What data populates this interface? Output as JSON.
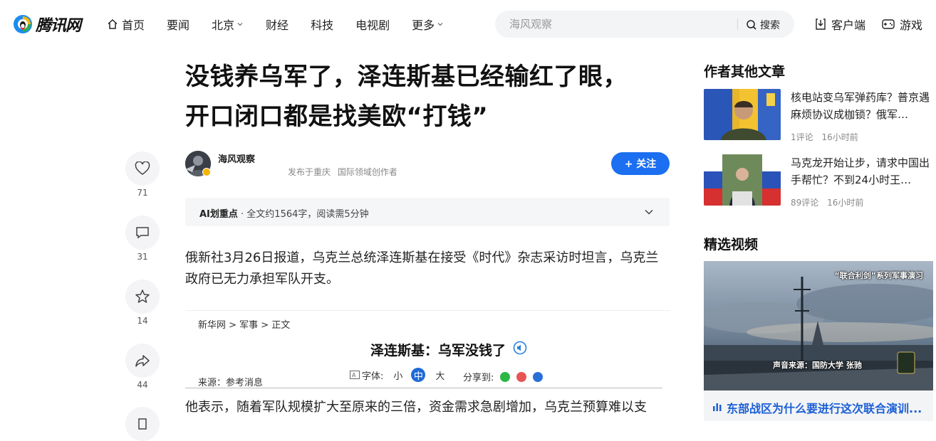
{
  "header": {
    "logo_text": "腾讯网",
    "nav": [
      {
        "label": "首页"
      },
      {
        "label": "要闻"
      },
      {
        "label": "北京"
      },
      {
        "label": "财经"
      },
      {
        "label": "科技"
      },
      {
        "label": "电视剧"
      },
      {
        "label": "更多"
      }
    ],
    "search_placeholder": "海风观察",
    "search_button": "搜索",
    "client_label": "客户端",
    "games_label": "游戏"
  },
  "rail": {
    "like_count": "71",
    "comment_count": "31",
    "favorite_count": "14",
    "share_count": "44"
  },
  "article": {
    "title_line1": "没钱养乌军了，泽连斯基已经输红了眼，",
    "title_line2": "开口闭口都是找美欧“打钱”",
    "author": "海风观察",
    "location": "发布于重庆",
    "author_title": "国际领域创作者",
    "follow_label": "+ 关注",
    "ai_label": "AI划重点",
    "ai_summary": " · 全文约1564字，阅读需5分钟",
    "para1": "俄新社3月26日报道，乌克兰总统泽连斯基在接受《时代》杂志采访时坦言，乌克兰政府已无力承担军队开支。",
    "embed": {
      "breadcrumb": "新华网 > 军事 > 正文",
      "title": "泽连斯基：乌军没钱了",
      "source": "来源：参考消息",
      "font_label": "字体:",
      "font_small": "小",
      "font_medium": "中",
      "font_large": "大",
      "share_label": "分享到:"
    },
    "para2": "他表示，随着军队规模扩大至原来的三倍，资金需求急剧增加，乌克兰预算难以支"
  },
  "sidebar": {
    "more_heading": "作者其他文章",
    "articles": [
      {
        "title": "核电站变乌军弹药库？普京遇麻烦协议成枷锁？俄军…",
        "comments": "1评论",
        "time": "16小时前"
      },
      {
        "title": "马克龙开始让步，请求中国出手帮忙？不到24小时王…",
        "comments": "89评论",
        "time": "16小时前"
      }
    ],
    "video_heading": "精选视频",
    "video": {
      "caption_top": "“联合利剑”系列军事演习",
      "caption_bottom": "声音来源：国防大学 张驰",
      "title": "东部战区为什么要进行这次联合演训..."
    }
  },
  "colors": {
    "accent": "#1b6ff0",
    "link_blue": "#1b5fd6"
  }
}
